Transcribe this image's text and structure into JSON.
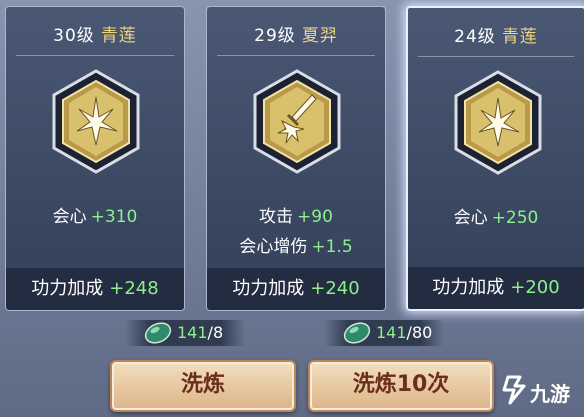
{
  "cards": [
    {
      "level": "30级",
      "name": "青莲",
      "stats": [
        {
          "label": "会心",
          "value": "+310"
        }
      ],
      "bonus_label": "功力加成",
      "bonus_value": "+248",
      "emblem_icon": "crit-burst-icon",
      "selected": false
    },
    {
      "level": "29级",
      "name": "夏羿",
      "stats": [
        {
          "label": "攻击",
          "value": "+90"
        },
        {
          "label": "会心增伤",
          "value": "+1.5"
        }
      ],
      "bonus_label": "功力加成",
      "bonus_value": "+240",
      "emblem_icon": "sword-burst-icon",
      "selected": false
    },
    {
      "level": "24级",
      "name": "青莲",
      "stats": [
        {
          "label": "会心",
          "value": "+250"
        }
      ],
      "bonus_label": "功力加成",
      "bonus_value": "+200",
      "emblem_icon": "crit-burst-icon",
      "selected": true
    }
  ],
  "costs": [
    {
      "have": "141",
      "sep": "/",
      "need": "8",
      "icon": "jade-stone-icon"
    },
    {
      "have": "141",
      "sep": "/",
      "need": "80",
      "icon": "jade-stone-icon"
    }
  ],
  "buttons": {
    "refine": "洗炼",
    "refine10": "洗炼10次"
  },
  "watermark": {
    "text": "九游",
    "logo": "jiuyou-logo"
  },
  "colors": {
    "stat_value": "#8cf08c",
    "name_gold": "#f0d482",
    "button_text": "#6a2e1c"
  }
}
